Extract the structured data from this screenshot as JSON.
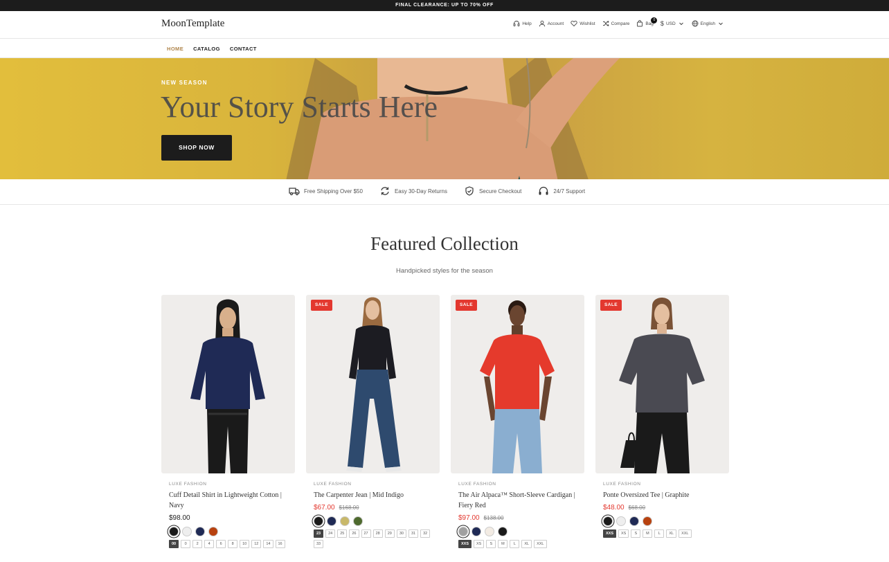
{
  "announcement": "FINAL CLEARANCE: UP TO 70% OFF",
  "header": {
    "logo": "MoonTemplate",
    "help": "Help",
    "account": "Account",
    "wishlist": "Wishlist",
    "compare": "Compare",
    "bag": "Bag",
    "bag_count": "0",
    "currency": "USD",
    "language": "English"
  },
  "nav": [
    "HOME",
    "CATALOG",
    "CONTACT"
  ],
  "hero": {
    "eyebrow": "NEW SEASON",
    "title": "Your Story Starts Here",
    "button": "SHOP NOW"
  },
  "features": [
    {
      "icon": "truck-icon",
      "label": "Free Shipping Over $50"
    },
    {
      "icon": "returns-icon",
      "label": "Easy 30-Day Returns"
    },
    {
      "icon": "shield-icon",
      "label": "Secure Checkout"
    },
    {
      "icon": "headphones-icon",
      "label": "24/7 Support"
    }
  ],
  "section": {
    "title": "Featured Collection",
    "subtitle": "Handpicked styles for the season"
  },
  "products": [
    {
      "sale": false,
      "brand": "LUXE FASHION",
      "name": "Cuff Detail Shirt in Lightweight Cotton | Navy",
      "price": "$98.00",
      "compare": "",
      "swatches": [
        "#1a1a1a",
        "#eeeeee",
        "#1f2a55",
        "#b8420f"
      ],
      "sizes": [
        "00",
        "0",
        "2",
        "4",
        "6",
        "8",
        "10",
        "12",
        "14",
        "16"
      ],
      "selected_size": "00"
    },
    {
      "sale": true,
      "sale_label": "SALE",
      "brand": "LUXE FASHION",
      "name": "The Carpenter Jean | Mid Indigo",
      "price": "$67.00",
      "compare": "$168.00",
      "swatches": [
        "#1a1a1a",
        "#1f2a55",
        "#c8b86a",
        "#4e6a2e"
      ],
      "sizes": [
        "23",
        "24",
        "25",
        "26",
        "27",
        "28",
        "29",
        "30",
        "31",
        "32",
        "33"
      ],
      "selected_size": "23"
    },
    {
      "sale": true,
      "sale_label": "SALE",
      "brand": "LUXE FASHION",
      "name": "The Air Alpaca™ Short-Sleeve Cardigan | Fiery Red",
      "price": "$97.00",
      "compare": "$138.00",
      "swatches": [
        "#a0a0a0",
        "#1f2a55",
        "#f3ece4",
        "#1a1a1a"
      ],
      "sizes": [
        "XXS",
        "XS",
        "S",
        "M",
        "L",
        "XL",
        "XXL"
      ],
      "selected_size": "XXS"
    },
    {
      "sale": true,
      "sale_label": "SALE",
      "brand": "LUXE FASHION",
      "name": "Ponte Oversized Tee | Graphite",
      "price": "$48.00",
      "compare": "$68.00",
      "swatches": [
        "#1a1a1a",
        "#eeeeee",
        "#1f2a55",
        "#b8420f"
      ],
      "sizes": [
        "XXS",
        "XS",
        "S",
        "M",
        "L",
        "XL",
        "XXL"
      ],
      "selected_size": "XXS"
    }
  ]
}
